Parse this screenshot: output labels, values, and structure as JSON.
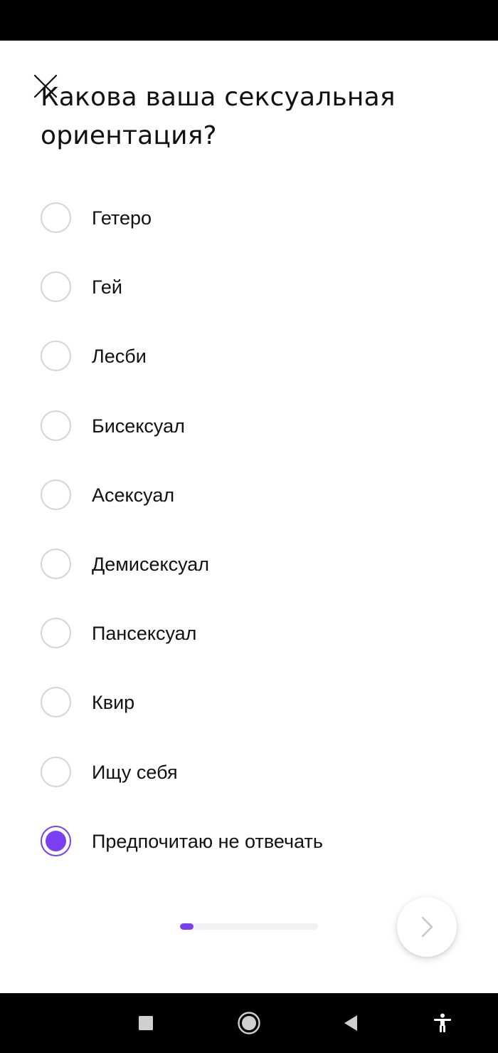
{
  "title": "Какова ваша сексуальная ориентация?",
  "options": [
    {
      "label": "Гетеро",
      "selected": false
    },
    {
      "label": "Гей",
      "selected": false
    },
    {
      "label": "Лесби",
      "selected": false
    },
    {
      "label": "Бисексуал",
      "selected": false
    },
    {
      "label": "Асексуал",
      "selected": false
    },
    {
      "label": "Демисексуал",
      "selected": false
    },
    {
      "label": "Пансексуал",
      "selected": false
    },
    {
      "label": "Квир",
      "selected": false
    },
    {
      "label": "Ищу себя",
      "selected": false
    },
    {
      "label": "Предпочитаю не отвечать",
      "selected": true
    }
  ],
  "progress": {
    "value": 0.1
  },
  "icons": {
    "close": "close-icon",
    "next": "chevron-right-icon",
    "nav_recents": "square-icon",
    "nav_home": "circle-icon",
    "nav_back": "triangle-back-icon",
    "nav_accessibility": "accessibility-icon"
  },
  "colors": {
    "accent": "#7a3ff2",
    "radio_border": "#d5d5d5",
    "progress_track": "#f1f1f3",
    "system_bars": "#000000"
  }
}
